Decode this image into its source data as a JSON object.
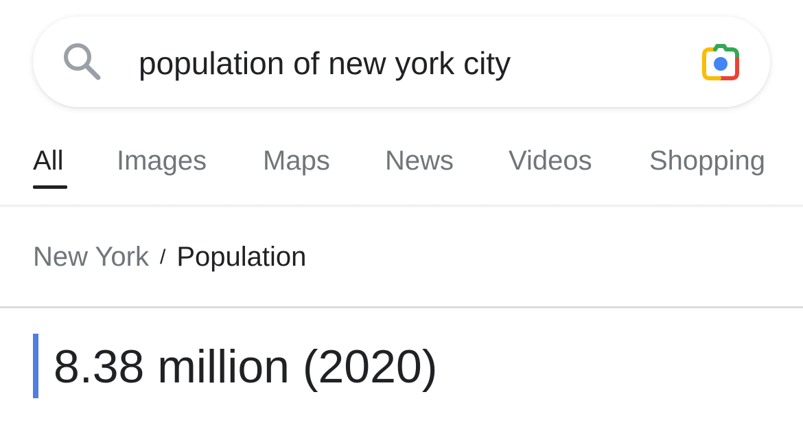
{
  "search": {
    "query": "population of new york city",
    "search_icon": "search-icon",
    "lens_icon": "google-lens-camera-icon"
  },
  "tabs": [
    {
      "label": "All",
      "active": true
    },
    {
      "label": "Images",
      "active": false
    },
    {
      "label": "Maps",
      "active": false
    },
    {
      "label": "News",
      "active": false
    },
    {
      "label": "Videos",
      "active": false
    },
    {
      "label": "Shopping",
      "active": false
    }
  ],
  "breadcrumb": {
    "parent": "New York",
    "separator": "/",
    "current": "Population"
  },
  "answer": {
    "value": "8.38 million (2020)"
  },
  "colors": {
    "accent_bar": "#4f7fe0",
    "text_primary": "#202124",
    "text_secondary": "#70757a",
    "lens_blue": "#4285F4",
    "lens_red": "#EA4335",
    "lens_yellow": "#FBBC04",
    "lens_green": "#34A853"
  }
}
